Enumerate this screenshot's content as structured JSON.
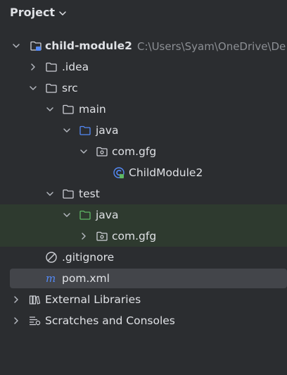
{
  "panel": {
    "title": "Project"
  },
  "tree": {
    "module": "child-module2",
    "module_path": "C:\\Users\\Syam\\OneDrive\\De",
    "idea": ".idea",
    "src": "src",
    "main": "main",
    "main_java": "java",
    "main_pkg": "com.gfg",
    "main_class": "ChildModule2",
    "test": "test",
    "test_java": "java",
    "test_pkg": "com.gfg",
    "gitignore": ".gitignore",
    "pom": "pom.xml",
    "external_libraries": "External Libraries",
    "scratches": "Scratches and Consoles"
  },
  "colors": {
    "background": "#2b2d30",
    "text": "#dfe1e5",
    "muted": "#8c8f94",
    "source_folder": "#548af7",
    "test_folder": "#5fb865",
    "test_rows_bg": "#2e3a2f",
    "selected_bg": "#43454a"
  }
}
